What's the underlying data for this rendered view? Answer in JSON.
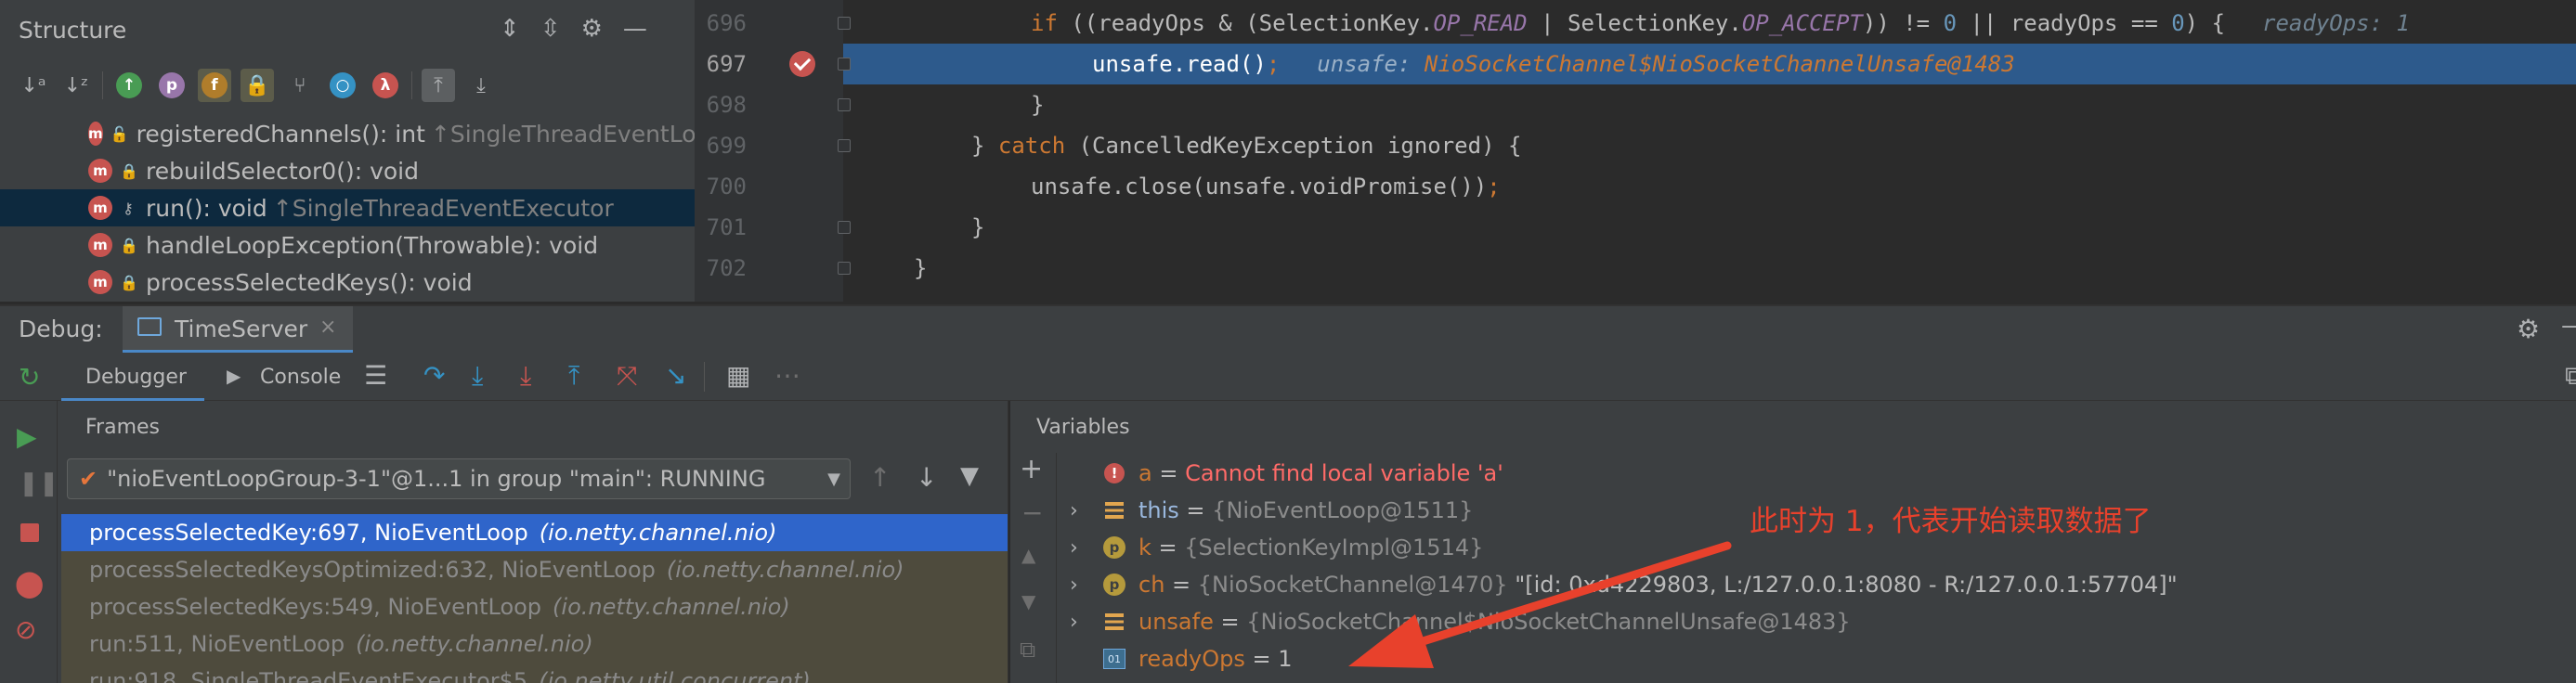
{
  "structure": {
    "title": "Structure",
    "items": [
      {
        "name": "registeredChannels(): int",
        "inherited": "↑SingleThreadEventLo",
        "lock": "green"
      },
      {
        "name": "rebuildSelector0(): void",
        "inherited": "",
        "lock": "red"
      },
      {
        "name": "run(): void",
        "inherited": "↑SingleThreadEventExecutor",
        "lock": "key"
      },
      {
        "name": "handleLoopException(Throwable): void",
        "inherited": "",
        "lock": "red"
      },
      {
        "name": "processSelectedKeys(): void",
        "inherited": "",
        "lock": "red"
      }
    ]
  },
  "editor": {
    "lines": [
      {
        "num": "696"
      },
      {
        "num": "697"
      },
      {
        "num": "698"
      },
      {
        "num": "699"
      },
      {
        "num": "700"
      },
      {
        "num": "701"
      },
      {
        "num": "702"
      }
    ],
    "l696": {
      "p1": "if",
      "p2": " ((readyOps & (SelectionKey.",
      "c1": "OP_READ",
      "p3": " | SelectionKey.",
      "c2": "OP_ACCEPT",
      "p4": ")) != ",
      "n1": "0",
      "p5": " || readyOps == ",
      "n2": "0",
      "p6": ") {",
      "inline": "readyOps: 1"
    },
    "l697": {
      "code": "unsafe.read()",
      "semi": ";",
      "inline_name": "unsafe:",
      "inline_value": "NioSocketChannel$NioSocketChannelUnsafe@1483"
    },
    "l698": {
      "code": "}"
    },
    "l699": {
      "p1": "} ",
      "kw": "catch",
      "p2": " (CancelledKeyException ignored) {"
    },
    "l700": {
      "code": "unsafe.close(unsafe.voidPromise())",
      "semi": ";"
    },
    "l701": {
      "code": "}"
    },
    "l702": {
      "code": "}"
    }
  },
  "debug": {
    "label": "Debug:",
    "session": "TimeServer",
    "tabs": {
      "debugger": "Debugger",
      "console": "Console"
    },
    "frames_title": "Frames",
    "thread": "\"nioEventLoopGroup-3-1\"@1...1 in group \"main\": RUNNING",
    "frames": [
      {
        "method": "processSelectedKey:697, NioEventLoop",
        "pkg": "(io.netty.channel.nio)"
      },
      {
        "method": "processSelectedKeysOptimized:632, NioEventLoop",
        "pkg": "(io.netty.channel.nio)"
      },
      {
        "method": "processSelectedKeys:549, NioEventLoop",
        "pkg": "(io.netty.channel.nio)"
      },
      {
        "method": "run:511, NioEventLoop",
        "pkg": "(io.netty.channel.nio)"
      },
      {
        "method": "run:918, SingleThreadEventExecutor$5",
        "pkg": "(io.netty.util.concurrent)"
      }
    ],
    "variables_title": "Variables",
    "variables": [
      {
        "name": "a",
        "eq": " = ",
        "value": "Cannot find local variable 'a'"
      },
      {
        "name": "this",
        "eq": " = ",
        "value": "{NioEventLoop@1511}"
      },
      {
        "name": "k",
        "eq": " = ",
        "value": "{SelectionKeyImpl@1514}"
      },
      {
        "name": "ch",
        "eq": " = ",
        "value": "{NioSocketChannel@1470}",
        "extra": " \"[id: 0xd4229803, L:/127.0.0.1:8080 - R:/127.0.0.1:57704]\""
      },
      {
        "name": "unsafe",
        "eq": " = ",
        "value": "{NioSocketChannel$NioSocketChannelUnsafe@1483}"
      },
      {
        "name": "readyOps",
        "eq": " = ",
        "value": "1"
      }
    ],
    "annotation": "此时为 1，代表开始读取数据了"
  },
  "colors": {
    "accent": "#2f65ca",
    "annotation": "#e8412c",
    "highlight": "#2d5a8c"
  }
}
